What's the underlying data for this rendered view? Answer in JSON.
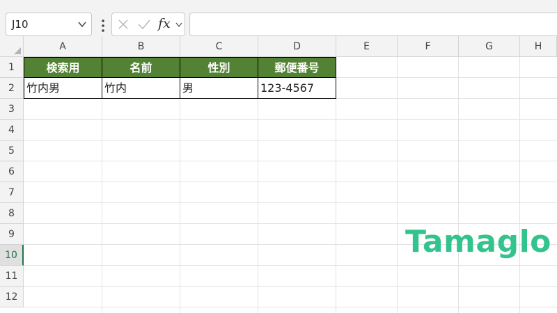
{
  "name_box": {
    "value": "J10"
  },
  "formula_bar": {
    "fx_label": "fx",
    "formula_value": ""
  },
  "columns": [
    "A",
    "B",
    "C",
    "D",
    "E",
    "F",
    "G",
    "H"
  ],
  "rows": [
    "1",
    "2",
    "3",
    "4",
    "5",
    "6",
    "7",
    "8",
    "9",
    "10",
    "11",
    "12"
  ],
  "selected_row": "10",
  "table": {
    "headers": [
      "検索用",
      "名前",
      "性別",
      "郵便番号"
    ],
    "row": [
      "竹内男",
      "竹内",
      "男",
      "123-4567"
    ]
  },
  "colors": {
    "header_fill": "#548235",
    "selection": "#217346",
    "brand": "#33c48d"
  },
  "brand": {
    "text": "Tamaglo"
  }
}
